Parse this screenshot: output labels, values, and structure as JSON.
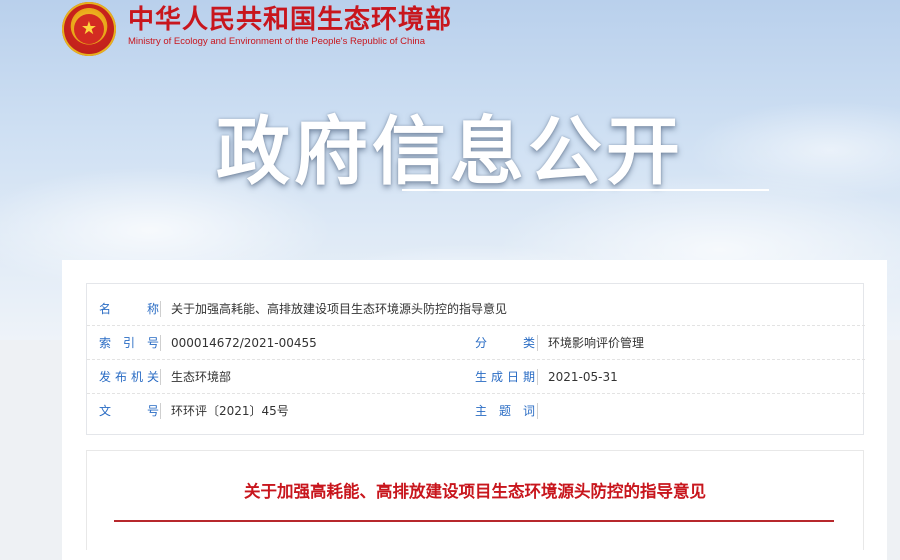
{
  "header": {
    "org_cn": "中华人民共和国生态环境部",
    "org_en": "Ministry of Ecology and Environment of the People's Republic of China",
    "emblem_icon": "national-emblem-icon"
  },
  "banner": {
    "title": "政府信息公开"
  },
  "meta": {
    "name_label": "名　　称",
    "name_value": "关于加强高耗能、高排放建设项目生态环境源头防控的指导意见",
    "index_label": "索 引 号",
    "index_value": "000014672/2021-00455",
    "category_label": "分　　类",
    "category_value": "环境影响评价管理",
    "issuer_label": "发布机关",
    "issuer_value": "生态环境部",
    "date_label": "生成日期",
    "date_value": "2021-05-31",
    "docno_label": "文　　号",
    "docno_value": "环环评〔2021〕45号",
    "keywords_label": "主 题 词",
    "keywords_value": ""
  },
  "document": {
    "title": "关于加强高耗能、高排放建设项目生态环境源头防控的指导意见"
  },
  "colors": {
    "brand_red": "#c8161d",
    "label_blue": "#2a6cc4"
  }
}
